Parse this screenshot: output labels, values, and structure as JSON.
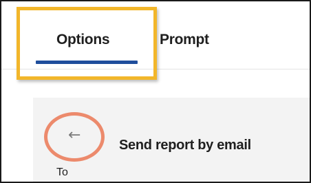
{
  "tabs": [
    {
      "label": "Options",
      "selected": true
    },
    {
      "label": "Prompt",
      "selected": false
    }
  ],
  "panel": {
    "title": "Send report by email",
    "back_icon": "arrow-left-icon",
    "to_label": "To"
  },
  "colors": {
    "accent": "#1f4e9c",
    "highlight_box": "#f2b62a",
    "highlight_circle": "#ec8a6c",
    "panel_background": "#f3f3f3"
  }
}
